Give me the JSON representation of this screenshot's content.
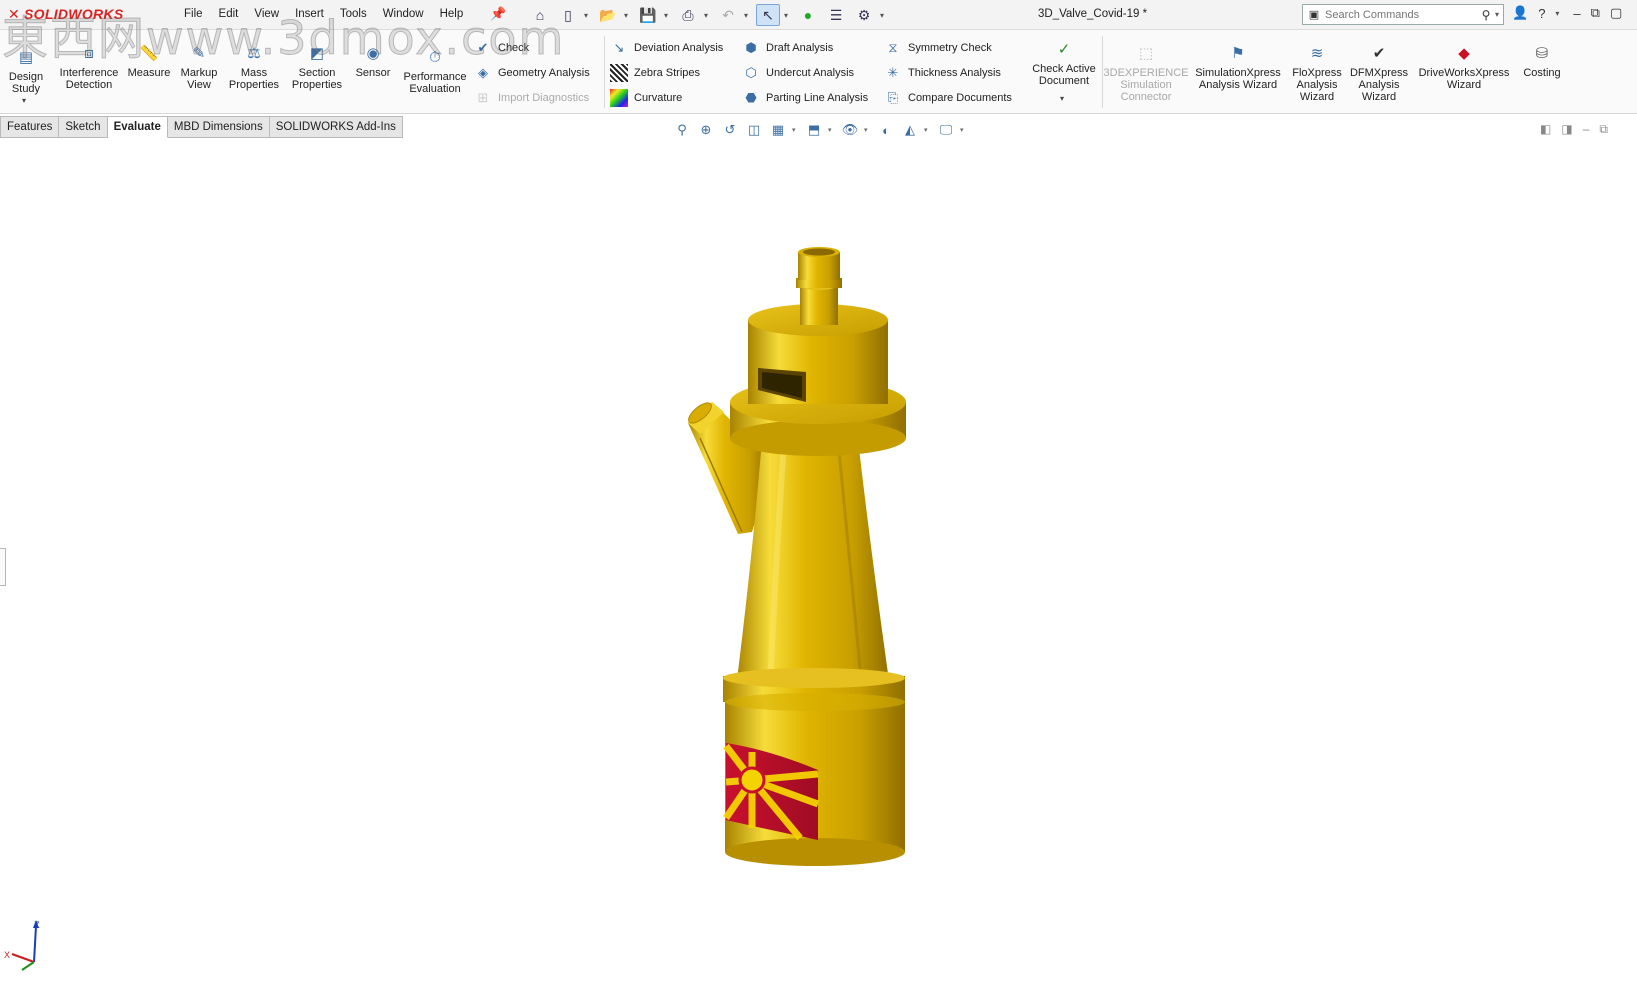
{
  "app": {
    "logo_text": "SOLIDWORKS",
    "document_title": "3D_Valve_Covid-19 *",
    "watermark": "東西网www.3dmox.com"
  },
  "menu": [
    "File",
    "Edit",
    "View",
    "Insert",
    "Tools",
    "Window",
    "Help"
  ],
  "search": {
    "placeholder": "Search Commands"
  },
  "ribbon": {
    "design_study": "Design Study",
    "interference_detection": "Interference Detection",
    "measure": "Measure",
    "markup_view": "Markup View",
    "mass_properties": "Mass Properties",
    "section_properties": "Section Properties",
    "sensor": "Sensor",
    "performance_evaluation": "Performance Evaluation",
    "check": "Check",
    "geometry_analysis": "Geometry Analysis",
    "import_diagnostics": "Import Diagnostics",
    "deviation_analysis": "Deviation Analysis",
    "zebra_stripes": "Zebra Stripes",
    "curvature": "Curvature",
    "draft_analysis": "Draft Analysis",
    "undercut_analysis": "Undercut Analysis",
    "parting_line_analysis": "Parting Line Analysis",
    "symmetry_check": "Symmetry Check",
    "thickness_analysis": "Thickness Analysis",
    "compare_documents": "Compare Documents",
    "check_active_document": "Check Active Document",
    "experience_connector": "3DEXPERIENCE Simulation Connector",
    "simulationxpress": "SimulationXpress Analysis Wizard",
    "floxpress": "FloXpress Analysis Wizard",
    "dfmxpress": "DFMXpress Analysis Wizard",
    "driveworksxpress": "DriveWorksXpress Wizard",
    "costing": "Costing"
  },
  "tabs": [
    {
      "label": "Features"
    },
    {
      "label": "Sketch"
    },
    {
      "label": "Evaluate",
      "active": true
    },
    {
      "label": "MBD Dimensions"
    },
    {
      "label": "SOLIDWORKS Add-Ins"
    }
  ],
  "triad": {
    "x": "X",
    "z": "Z"
  },
  "colors": {
    "model_gold": "#e0b500",
    "model_highlight": "#f6dc3a",
    "model_shadow": "#a88300",
    "logo_red": "#dd2222",
    "flag_red": "#c8102e",
    "flag_yellow": "#f5d300"
  }
}
